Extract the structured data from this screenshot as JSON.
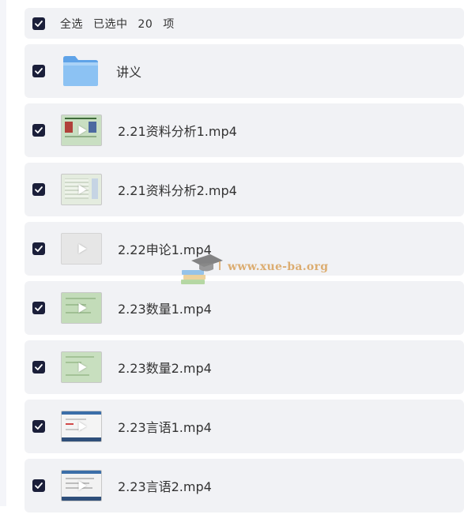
{
  "header": {
    "select_all_label": "全选",
    "selected_prefix": "已选中",
    "selected_count": "20",
    "selected_suffix": "项"
  },
  "items": [
    {
      "name": "讲义",
      "type": "folder",
      "checked": true
    },
    {
      "name": "2.21资料分析1.mp4",
      "type": "video",
      "checked": true
    },
    {
      "name": "2.21资料分析2.mp4",
      "type": "video",
      "checked": true
    },
    {
      "name": "2.22申论1.mp4",
      "type": "video",
      "checked": true
    },
    {
      "name": "2.23数量1.mp4",
      "type": "video",
      "checked": true
    },
    {
      "name": "2.23数量2.mp4",
      "type": "video",
      "checked": true
    },
    {
      "name": "2.23言语1.mp4",
      "type": "video",
      "checked": true
    },
    {
      "name": "2.23言语2.mp4",
      "type": "video",
      "checked": true
    }
  ],
  "watermark": {
    "text": "www.xue-ba.org"
  },
  "icons": {
    "checkbox": "checkmark-icon",
    "folder": "folder-icon",
    "video": "video-thumbnail-icon",
    "play": "play-icon"
  },
  "colors": {
    "row_bg": "#f1f2f5",
    "checkbox_bg": "#1b1f3a",
    "folder": "#7db8ef",
    "watermark": "#d9a25b"
  }
}
